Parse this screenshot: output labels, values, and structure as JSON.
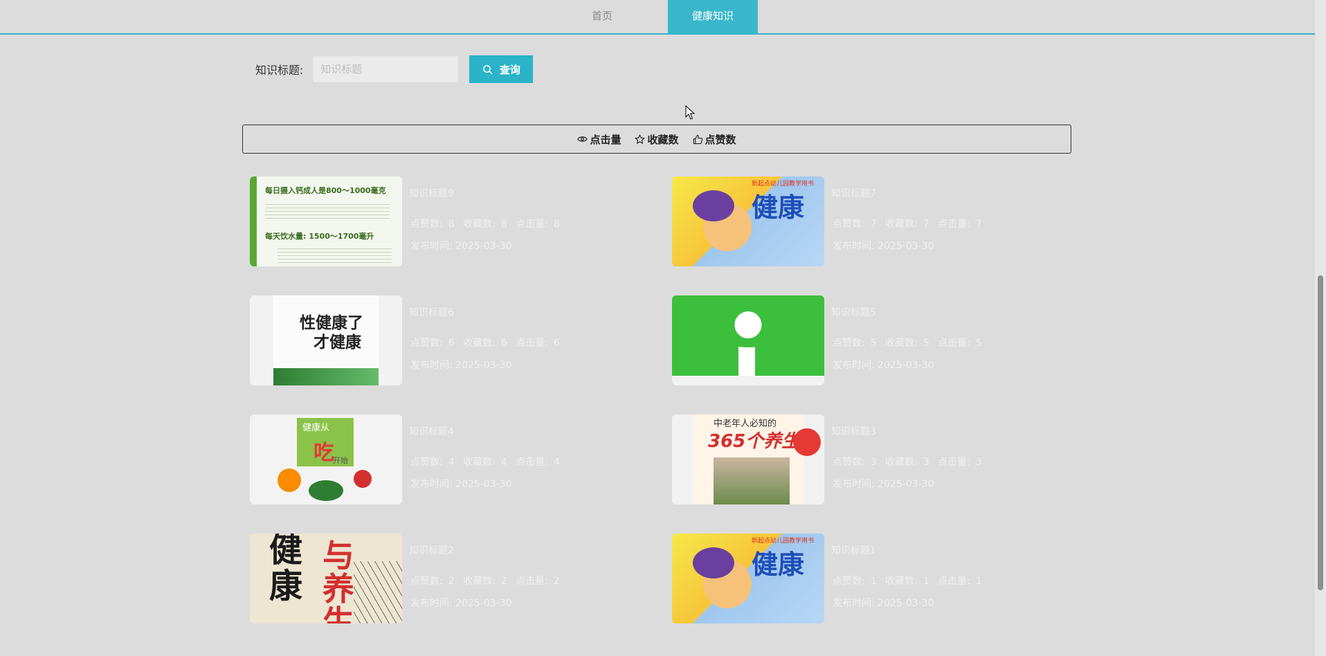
{
  "nav": {
    "items": [
      {
        "label": "首页",
        "active": false
      },
      {
        "label": "健康知识",
        "active": true
      }
    ]
  },
  "search": {
    "label": "知识标题:",
    "placeholder": "知识标题",
    "button_label": "查询"
  },
  "sort": {
    "items": [
      {
        "label": "点击量",
        "icon": "eye-icon"
      },
      {
        "label": "收藏数",
        "icon": "star-icon"
      },
      {
        "label": "点赞数",
        "icon": "thumbs-up-icon"
      }
    ]
  },
  "stat_labels": {
    "likes": "点赞数:",
    "favorites": "收藏数:",
    "clicks": "点击量:",
    "publish": "发布时间:"
  },
  "cards": [
    {
      "title": "知识标题9",
      "likes": "8",
      "favorites": "8",
      "clicks": "8",
      "date": "2025-03-30",
      "thumb": {
        "lines": [
          "每日摄入钙成人是800～1000毫克",
          "每天饮水量: 1500～1700毫升"
        ]
      }
    },
    {
      "title": "知识标题7",
      "likes": "7",
      "favorites": "7",
      "clicks": "7",
      "date": "2025-03-30",
      "thumb": {
        "lines": [
          "新起点幼儿园教学用书",
          "健康"
        ]
      }
    },
    {
      "title": "知识标题6",
      "likes": "6",
      "favorites": "6",
      "clicks": "6",
      "date": "2025-03-30",
      "thumb": {
        "lines": [
          "性健康了",
          "才健康"
        ]
      }
    },
    {
      "title": "知识标题5",
      "likes": "5",
      "favorites": "5",
      "clicks": "5",
      "date": "2025-03-30",
      "thumb": {
        "lines": []
      }
    },
    {
      "title": "知识标题4",
      "likes": "4",
      "favorites": "4",
      "clicks": "4",
      "date": "2025-03-30",
      "thumb": {
        "lines": [
          "健康从",
          "吃",
          "开始"
        ]
      }
    },
    {
      "title": "知识标题3",
      "likes": "3",
      "favorites": "3",
      "clicks": "3",
      "date": "2025-03-30",
      "thumb": {
        "lines": [
          "中老年人必知的",
          "365个养生法"
        ]
      }
    },
    {
      "title": "知识标题2",
      "likes": "2",
      "favorites": "2",
      "clicks": "2",
      "date": "2025-03-30",
      "thumb": {
        "lines": [
          "健康",
          "与养生"
        ]
      }
    },
    {
      "title": "知识标题1",
      "likes": "1",
      "favorites": "1",
      "clicks": "1",
      "date": "2025-03-30",
      "thumb": {
        "lines": [
          "新起点幼儿园教学用书",
          "健康"
        ]
      }
    }
  ],
  "colors": {
    "accent": "#2bb3c9",
    "background": "#dcdcdc",
    "text_faint": "#f0f0f0"
  }
}
